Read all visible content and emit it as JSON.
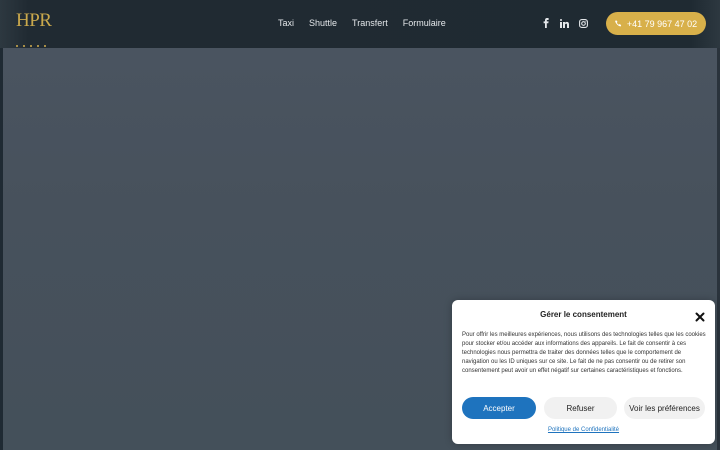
{
  "header": {
    "logo": {
      "text": "HPR"
    },
    "nav": [
      {
        "label": "Taxi"
      },
      {
        "label": "Shuttle"
      },
      {
        "label": "Transfert"
      },
      {
        "label": "Formulaire"
      }
    ],
    "social": [
      "facebook-icon",
      "linkedin-icon",
      "instagram-icon"
    ],
    "phone": {
      "label": "+41 79 967 47 02",
      "icon": "phone-icon"
    }
  },
  "consent": {
    "title": "Gérer le consentement",
    "body": "Pour offrir les meilleures expériences, nous utilisons des technologies telles que les cookies pour stocker et/ou accéder aux informations des appareils. Le fait de consentir à ces technologies nous permettra de traiter des données telles que le comportement de navigation ou les ID uniques sur ce site. Le fait de ne pas consentir ou de retirer son consentement peut avoir un effet négatif sur certaines caractéristiques et fonctions.",
    "accept_label": "Accepter",
    "refuse_label": "Refuser",
    "prefs_label": "Voir les préférences",
    "policy_link": "Politique de Confidentialité"
  },
  "colors": {
    "accent_gold": "#d8b04a",
    "primary_blue": "#1e73be",
    "hero_bg": "#46505b"
  }
}
